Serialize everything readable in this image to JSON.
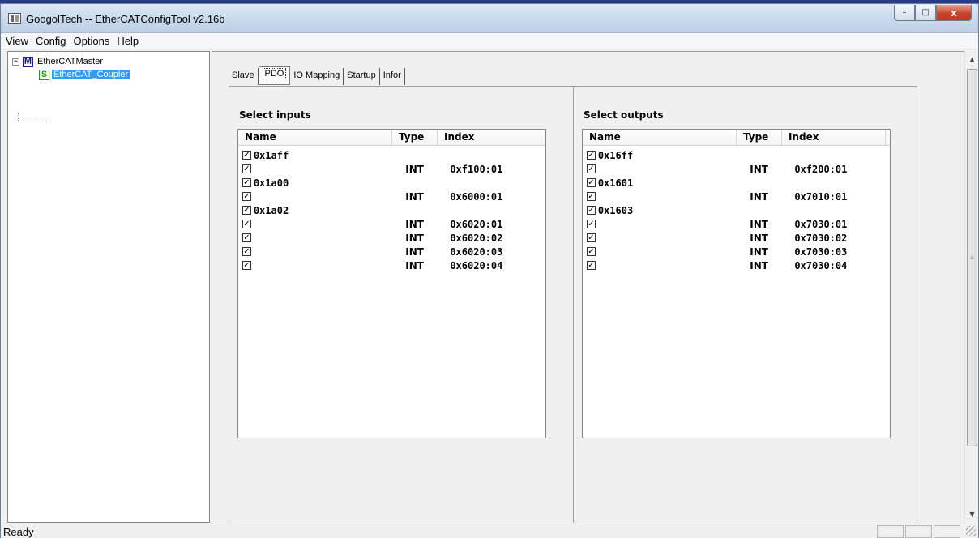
{
  "window": {
    "title": "GoogolTech -- EtherCATConfigTool v2.16b",
    "min_glyph": "–",
    "max_glyph": "□",
    "close_glyph": "x"
  },
  "menu": [
    "View",
    "Config",
    "Options",
    "Help"
  ],
  "tree": {
    "root": {
      "expander": "−",
      "icon_letter": "M",
      "label": "EtherCATMaster"
    },
    "child": {
      "icon_letter": "S",
      "label": "EtherCAT_Coupler"
    }
  },
  "tabs": [
    "Slave",
    "PDO",
    "IO Mapping",
    "Startup",
    "Infor"
  ],
  "active_tab": "PDO",
  "inputs": {
    "title": "Select inputs",
    "headers": {
      "name": "Name",
      "type": "Type",
      "index": "Index"
    },
    "rows": [
      {
        "checked": true,
        "name": "0x1aff",
        "type": "",
        "index": ""
      },
      {
        "checked": true,
        "name": "",
        "type": "INT",
        "index": "0xf100:01"
      },
      {
        "checked": true,
        "name": "0x1a00",
        "type": "",
        "index": ""
      },
      {
        "checked": true,
        "name": "",
        "type": "INT",
        "index": "0x6000:01"
      },
      {
        "checked": true,
        "name": "0x1a02",
        "type": "",
        "index": ""
      },
      {
        "checked": true,
        "name": "",
        "type": "INT",
        "index": "0x6020:01"
      },
      {
        "checked": true,
        "name": "",
        "type": "INT",
        "index": "0x6020:02"
      },
      {
        "checked": true,
        "name": "",
        "type": "INT",
        "index": "0x6020:03"
      },
      {
        "checked": true,
        "name": "",
        "type": "INT",
        "index": "0x6020:04"
      }
    ]
  },
  "outputs": {
    "title": "Select outputs",
    "headers": {
      "name": "Name",
      "type": "Type",
      "index": "Index"
    },
    "rows": [
      {
        "checked": true,
        "name": "0x16ff",
        "type": "",
        "index": ""
      },
      {
        "checked": true,
        "name": "",
        "type": "INT",
        "index": "0xf200:01"
      },
      {
        "checked": true,
        "name": "0x1601",
        "type": "",
        "index": ""
      },
      {
        "checked": true,
        "name": "",
        "type": "INT",
        "index": "0x7010:01"
      },
      {
        "checked": true,
        "name": "0x1603",
        "type": "",
        "index": ""
      },
      {
        "checked": true,
        "name": "",
        "type": "INT",
        "index": "0x7030:01"
      },
      {
        "checked": true,
        "name": "",
        "type": "INT",
        "index": "0x7030:02"
      },
      {
        "checked": true,
        "name": "",
        "type": "INT",
        "index": "0x7030:03"
      },
      {
        "checked": true,
        "name": "",
        "type": "INT",
        "index": "0x7030:04"
      }
    ]
  },
  "scrollbar": {
    "up_glyph": "▲",
    "down_glyph": "▼",
    "grip_glyph": "≡"
  },
  "status": {
    "text": "Ready"
  },
  "colors": {
    "selection": "#3399ff",
    "title_bar": "#c9d9ec",
    "close_button": "#c8442b"
  }
}
